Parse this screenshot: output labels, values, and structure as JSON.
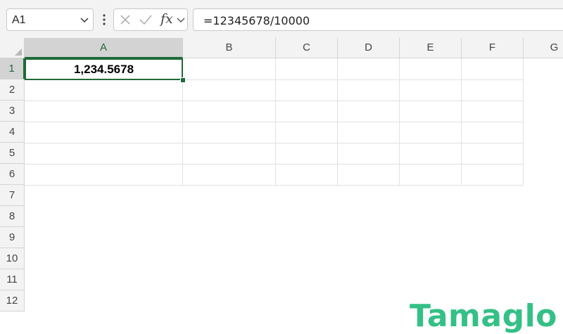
{
  "formula_bar": {
    "name_box": "A1",
    "fx_label": "fx",
    "formula": "=12345678/10000"
  },
  "columns": [
    "A",
    "B",
    "C",
    "D",
    "E",
    "F",
    "G"
  ],
  "selected_column": "A",
  "rows": [
    "1",
    "2",
    "3",
    "4",
    "5",
    "6",
    "7",
    "8",
    "9",
    "10",
    "11",
    "12"
  ],
  "selected_row": "1",
  "cells": {
    "A1": "1,234.5678"
  },
  "watermark": "Tamaglo",
  "colors": {
    "accent": "#1e6b37",
    "watermark": "#34c086",
    "header_bg": "#f3f3f3",
    "header_selected_bg": "#d3d3d3"
  },
  "icons": {
    "cancel": "x-icon",
    "enter": "check-icon",
    "function": "fx-icon",
    "name_box_dropdown": "chevron-down-icon",
    "more": "more-vertical-icon",
    "select_all": "triangle-corner-icon"
  }
}
